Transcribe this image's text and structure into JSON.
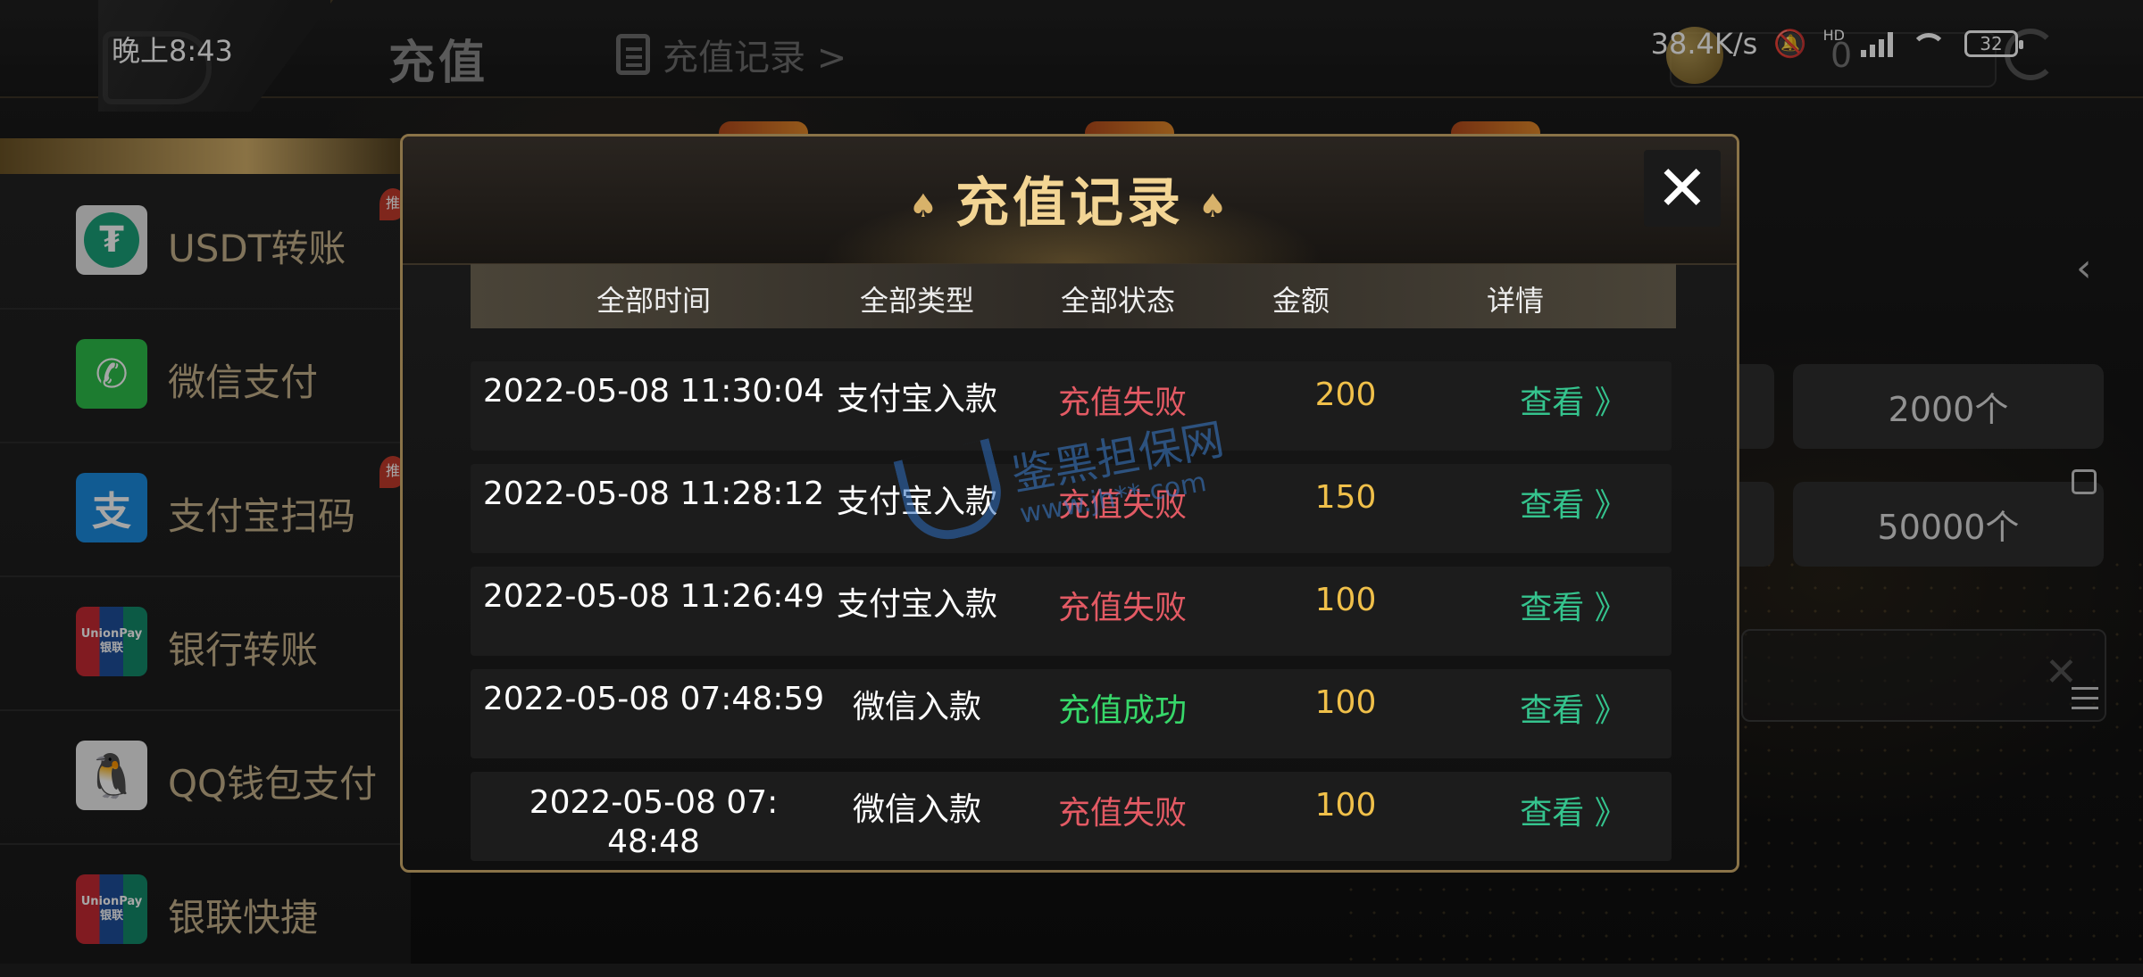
{
  "status_bar": {
    "time": "晚上8:43",
    "network_speed": "38.4K/s",
    "network_type": "HD",
    "battery": "32"
  },
  "header": {
    "title": "充值",
    "record_link": "充值记录 >",
    "coin_value": "0"
  },
  "sidebar": {
    "items": [
      {
        "label": "USDT转账",
        "icon": "usdt-icon",
        "icon_text": "₮",
        "color": "#1ba27a",
        "badge": "推"
      },
      {
        "label": "微信支付",
        "icon": "wechat-icon",
        "icon_text": "✆",
        "color": "#2dbf4a"
      },
      {
        "label": "支付宝扫码",
        "icon": "alipay-icon",
        "icon_text": "支",
        "color": "#1b8de0",
        "badge": "推"
      },
      {
        "label": "银行转账",
        "icon": "unionpay-icon",
        "icon_text": "UnionPay 银联",
        "color": "#c62a33"
      },
      {
        "label": "QQ钱包支付",
        "icon": "qq-icon",
        "icon_text": "🐧",
        "color": "#f0f0f0"
      },
      {
        "label": "银联快捷",
        "icon": "unionpay-icon",
        "icon_text": "UnionPay 银联",
        "color": "#c62a33"
      }
    ]
  },
  "right_panel": {
    "amount_options": [
      "2000个",
      "50000个"
    ]
  },
  "modal": {
    "title": "充值记录",
    "columns": [
      "全部时间",
      "全部类型",
      "全部状态",
      "金额",
      "详情"
    ],
    "rows": [
      {
        "time": "2022-05-08 11:30:04",
        "type": "支付宝入款",
        "status": "充值失败",
        "status_kind": "fail",
        "amount": "200",
        "detail": "查看 》"
      },
      {
        "time": "2022-05-08 11:28:12",
        "type": "支付宝入款",
        "status": "充值失败",
        "status_kind": "fail",
        "amount": "150",
        "detail": "查看 》"
      },
      {
        "time": "2022-05-08 11:26:49",
        "type": "支付宝入款",
        "status": "充值失败",
        "status_kind": "fail",
        "amount": "100",
        "detail": "查看 》"
      },
      {
        "time": "2022-05-08 07:48:59",
        "type": "微信入款",
        "status": "充值成功",
        "status_kind": "ok",
        "amount": "100",
        "detail": "查看 》"
      },
      {
        "time": "2022-05-08 07:48:48",
        "type": "微信入款",
        "status": "充值失败",
        "status_kind": "fail",
        "amount": "100",
        "detail": "查看 》"
      }
    ],
    "status_colors": {
      "fail": "#e35a64",
      "ok": "#37d86a"
    }
  },
  "watermark": {
    "text": "鉴黑担保网",
    "url": "www.jh**.com"
  }
}
